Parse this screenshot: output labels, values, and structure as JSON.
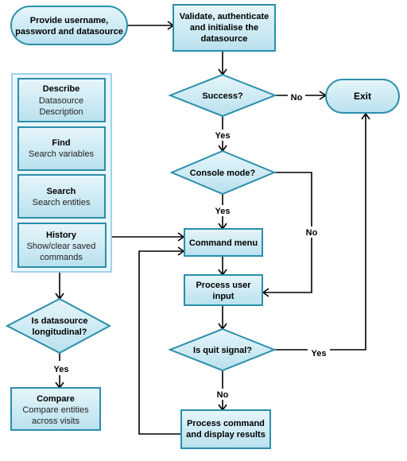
{
  "colors": {
    "node_fill_top": "#e6f5fa",
    "node_fill_bottom": "#b9e1ee",
    "node_stroke": "#2a8eaa",
    "group_border": "#9cd3ec",
    "edge": "#000000"
  },
  "nodes": {
    "start": [
      "Provide username,",
      "password and datasource"
    ],
    "validate": [
      "Validate, authenticate",
      "and initialise the",
      "datasource"
    ],
    "success": [
      "Success?"
    ],
    "exit": [
      "Exit"
    ],
    "console": [
      "Console mode?"
    ],
    "command_menu": [
      "Command menu"
    ],
    "process_input": [
      "Process user",
      "input"
    ],
    "quit": [
      "Is quit signal?"
    ],
    "process_command": [
      "Process  command",
      "and display results"
    ],
    "longitudinal": [
      "Is datasource",
      "longitudinal?"
    ],
    "compare": {
      "title": "Compare",
      "desc": [
        "Compare entities",
        "across visits"
      ]
    }
  },
  "commands": [
    {
      "title": "Describe",
      "desc": [
        "Datasource",
        "Description"
      ]
    },
    {
      "title": "Find",
      "desc": [
        "Search variables"
      ]
    },
    {
      "title": "Search",
      "desc": [
        "Search entities"
      ]
    },
    {
      "title": "History",
      "desc": [
        "Show/clear saved",
        "commands"
      ]
    }
  ],
  "edge_labels": {
    "success_no": "No",
    "success_yes": "Yes",
    "console_yes": "Yes",
    "console_no": "No",
    "quit_yes": "Yes",
    "quit_no": "No",
    "longitudinal_yes": "Yes"
  }
}
